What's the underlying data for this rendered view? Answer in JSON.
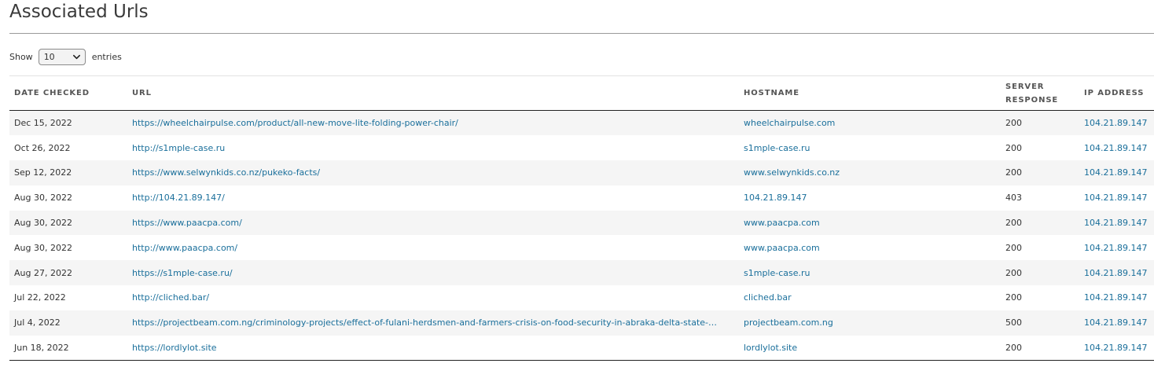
{
  "section": {
    "title": "Associated Urls"
  },
  "length": {
    "show_label": "Show",
    "selected": "10",
    "entries_label": "entries"
  },
  "table": {
    "headers": {
      "date": "DATE CHECKED",
      "url": "URL",
      "hostname": "HOSTNAME",
      "response": "SERVER RESPONSE",
      "ip": "IP ADDRESS"
    },
    "rows": [
      {
        "date": "Dec 15, 2022",
        "url": "https://wheelchairpulse.com/product/all-new-move-lite-folding-power-chair/",
        "hostname": "wheelchairpulse.com",
        "response": "200",
        "ip": "104.21.89.147"
      },
      {
        "date": "Oct 26, 2022",
        "url": "http://s1mple-case.ru",
        "hostname": "s1mple-case.ru",
        "response": "200",
        "ip": "104.21.89.147"
      },
      {
        "date": "Sep 12, 2022",
        "url": "https://www.selwynkids.co.nz/pukeko-facts/",
        "hostname": "www.selwynkids.co.nz",
        "response": "200",
        "ip": "104.21.89.147"
      },
      {
        "date": "Aug 30, 2022",
        "url": "http://104.21.89.147/",
        "hostname": "104.21.89.147",
        "response": "403",
        "ip": "104.21.89.147"
      },
      {
        "date": "Aug 30, 2022",
        "url": "https://www.paacpa.com/",
        "hostname": "www.paacpa.com",
        "response": "200",
        "ip": "104.21.89.147"
      },
      {
        "date": "Aug 30, 2022",
        "url": "http://www.paacpa.com/",
        "hostname": "www.paacpa.com",
        "response": "200",
        "ip": "104.21.89.147"
      },
      {
        "date": "Aug 27, 2022",
        "url": "https://s1mple-case.ru/",
        "hostname": "s1mple-case.ru",
        "response": "200",
        "ip": "104.21.89.147"
      },
      {
        "date": "Jul 22, 2022",
        "url": "http://cliched.bar/",
        "hostname": "cliched.bar",
        "response": "200",
        "ip": "104.21.89.147"
      },
      {
        "date": "Jul 4, 2022",
        "url": "https://projectbeam.com.ng/criminology-projects/effect-of-fulani-herdsmen-and-farmers-crisis-on-food-security-in-abraka-delta-state-…",
        "hostname": "projectbeam.com.ng",
        "response": "500",
        "ip": "104.21.89.147"
      },
      {
        "date": "Jun 18, 2022",
        "url": "https://lordlylot.site",
        "hostname": "lordlylot.site",
        "response": "200",
        "ip": "104.21.89.147"
      }
    ]
  },
  "colors": {
    "link": "#1a6f9b",
    "stripe": "#f5f5f5",
    "rule": "#222222"
  },
  "icons": {
    "select_arrow": "chevron-down-icon"
  }
}
